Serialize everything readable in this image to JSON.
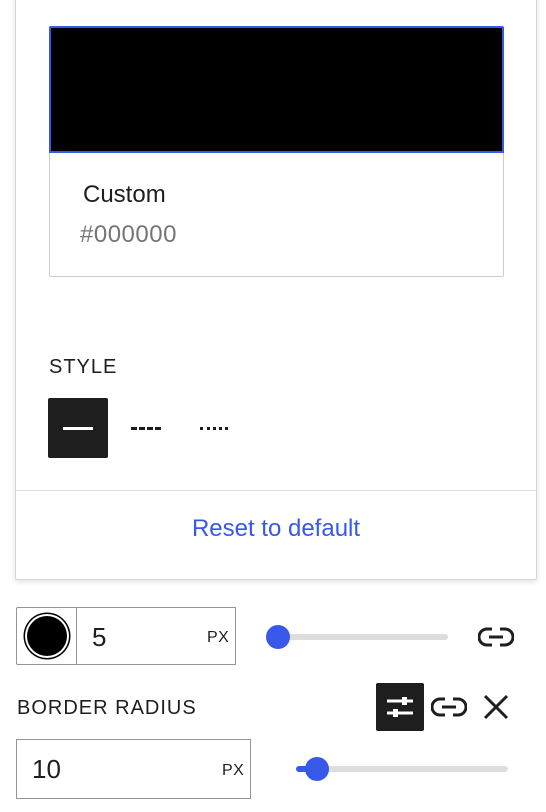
{
  "color_picker": {
    "name": "Custom",
    "hex": "#000000",
    "swatch_color": "#000000",
    "accent_color": "#3858e9"
  },
  "style": {
    "label": "STYLE",
    "options": [
      "solid",
      "dashed",
      "dotted"
    ],
    "selected": "solid"
  },
  "reset_label": "Reset to default",
  "border_width": {
    "value": "5",
    "unit": "PX",
    "slider_fraction": 0.05
  },
  "border_radius": {
    "label": "BORDER RADIUS",
    "value": "10",
    "unit": "PX",
    "slider_fraction": 0.1
  },
  "icons": {
    "style_solid": "solid-line-icon",
    "style_dashed": "dashed-line-icon",
    "style_dotted": "dotted-line-icon",
    "link": "link-icon",
    "settings": "sliders-icon",
    "close": "close-icon"
  }
}
